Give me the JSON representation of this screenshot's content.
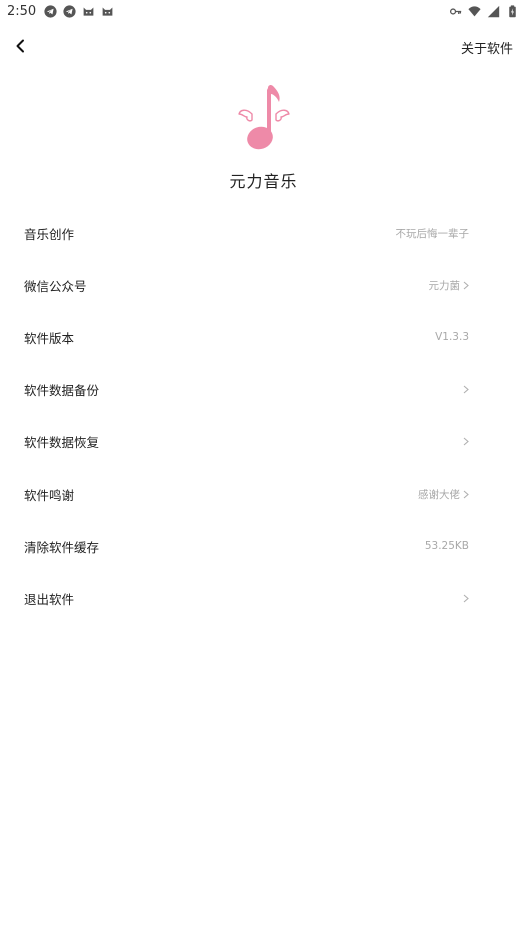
{
  "status_bar": {
    "time": "2:50",
    "left_icons": [
      "telegram-icon",
      "telegram-icon",
      "android-cat-icon",
      "android-cat-icon"
    ],
    "right_icons": [
      "vpn-key-icon",
      "wifi-icon",
      "signal-icon",
      "battery-icon"
    ]
  },
  "header": {
    "back_icon": "chevron-left-icon",
    "title": "关于软件"
  },
  "app": {
    "logo_icon": "winged-music-note-icon",
    "logo_color": "#ee8aa8",
    "name": "元力音乐"
  },
  "rows": [
    {
      "label": "音乐创作",
      "value": "不玩后悔一辈子",
      "chevron": false
    },
    {
      "label": "微信公众号",
      "value": "元力菌",
      "chevron": true
    },
    {
      "label": "软件版本",
      "value": "V1.3.3",
      "chevron": false
    },
    {
      "label": "软件数据备份",
      "value": "",
      "chevron": true
    },
    {
      "label": "软件数据恢复",
      "value": "",
      "chevron": true
    },
    {
      "label": "软件鸣谢",
      "value": "感谢大佬",
      "chevron": true
    },
    {
      "label": "清除软件缓存",
      "value": "53.25KB",
      "chevron": false
    },
    {
      "label": "退出软件",
      "value": "",
      "chevron": true
    }
  ]
}
